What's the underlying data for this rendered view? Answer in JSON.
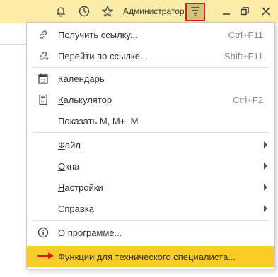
{
  "topbar": {
    "user_name": "Администратор",
    "icons": [
      "bell-icon",
      "history-icon",
      "star-icon",
      "main-menu-icon",
      "minimize-icon",
      "restore-icon",
      "close-icon"
    ]
  },
  "menu": {
    "get_link": {
      "label": "Получить ссылку...",
      "shortcut": "Ctrl+F11"
    },
    "go_link": {
      "label": "Перейти по ссылке...",
      "shortcut": "Shift+F11"
    },
    "calendar": {
      "label_first": "К",
      "label_rest": "алендарь",
      "icon_text": "13"
    },
    "calculator": {
      "label_first": "К",
      "label_rest": "алькулятор",
      "shortcut": "Ctrl+F2"
    },
    "show_m": {
      "label": "Показать M, M+, M-"
    },
    "file": {
      "label_first": "Ф",
      "label_rest": "айл"
    },
    "windows": {
      "label_first": "О",
      "label_rest": "кна"
    },
    "settings": {
      "label_first": "Н",
      "label_rest": "астройки"
    },
    "help": {
      "label_first": "С",
      "label_rest": "правка"
    },
    "about": {
      "label": "О программе..."
    },
    "tech": {
      "label": "Функции для технического специалиста..."
    }
  },
  "colors": {
    "topbar": "#fbeda8",
    "highlight": "#f9cc2a",
    "accent_red": "#e0141c"
  }
}
